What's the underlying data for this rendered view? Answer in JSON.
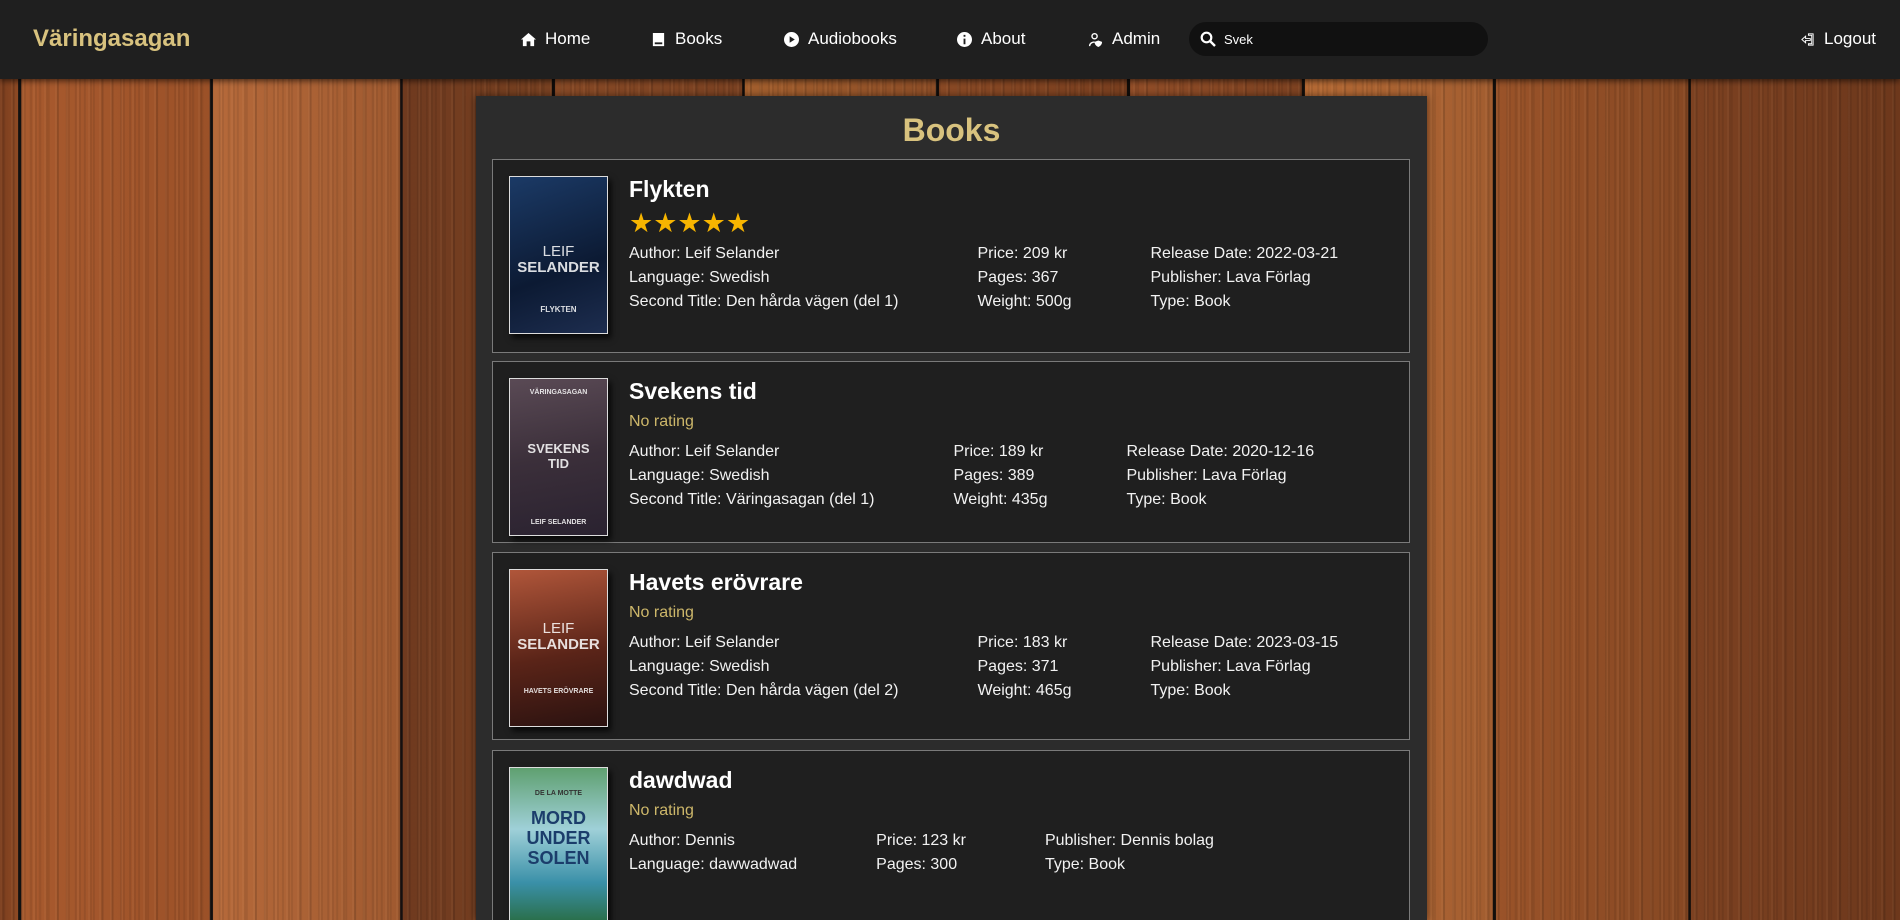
{
  "header": {
    "logo": "Väringasagan",
    "nav": [
      {
        "label": "Home",
        "icon": "home-icon"
      },
      {
        "label": "Books",
        "icon": "book-icon"
      },
      {
        "label": "Audiobooks",
        "icon": "play-circle-icon"
      },
      {
        "label": "About",
        "icon": "info-circle-icon"
      },
      {
        "label": "Admin",
        "icon": "user-shield-icon"
      }
    ],
    "search": {
      "value": "Svek"
    },
    "logout": "Logout"
  },
  "main": {
    "title": "Books",
    "books": [
      {
        "title": "Flykten",
        "rating": 5,
        "rating_text": "★★★★★",
        "cover_text": [
          "LEIF",
          "SELANDER",
          "FLYKTEN"
        ],
        "cols": [
          [
            "Author: Leif Selander",
            "Language: Swedish",
            "Second Title: Den hårda vägen (del 1)"
          ],
          [
            "Price: 209 kr",
            "Pages: 367",
            "Weight: 500g"
          ],
          [
            "Release Date: 2022-03-21",
            "Publisher: Lava Förlag",
            "Type: Book"
          ]
        ]
      },
      {
        "title": "Svekens tid",
        "rating_text": "No rating",
        "cover_text": [
          "VÄRINGASAGAN",
          "SVEKENS TID",
          "LEIF SELANDER"
        ],
        "cols": [
          [
            "Author: Leif Selander",
            "Language: Swedish",
            "Second Title: Väringasagan (del 1)"
          ],
          [
            "Price: 189 kr",
            "Pages: 389",
            "Weight: 435g"
          ],
          [
            "Release Date: 2020-12-16",
            "Publisher: Lava Förlag",
            "Type: Book"
          ]
        ]
      },
      {
        "title": "Havets erövrare",
        "rating_text": "No rating",
        "cover_text": [
          "LEIF",
          "SELANDER",
          "HAVETS ERÖVRARE"
        ],
        "cols": [
          [
            "Author: Leif Selander",
            "Language: Swedish",
            "Second Title: Den hårda vägen (del 2)"
          ],
          [
            "Price: 183 kr",
            "Pages: 371",
            "Weight: 465g"
          ],
          [
            "Release Date: 2023-03-15",
            "Publisher: Lava Förlag",
            "Type: Book"
          ]
        ]
      },
      {
        "title": "dawdwad",
        "rating_text": "No rating",
        "cover_text": [
          "DE LA MOTTE",
          "MORD UNDER SOLEN",
          ""
        ],
        "cols": [
          [
            "Author: Dennis",
            "Language: dawwadwad"
          ],
          [
            "Price: 123 kr",
            "Pages: 300"
          ],
          [
            "Publisher: Dennis bolag",
            "Type: Book"
          ]
        ]
      }
    ]
  },
  "colors": {
    "accent": "#d8c27e",
    "star": "#f7b500",
    "header_bg": "#1f1f1f"
  }
}
